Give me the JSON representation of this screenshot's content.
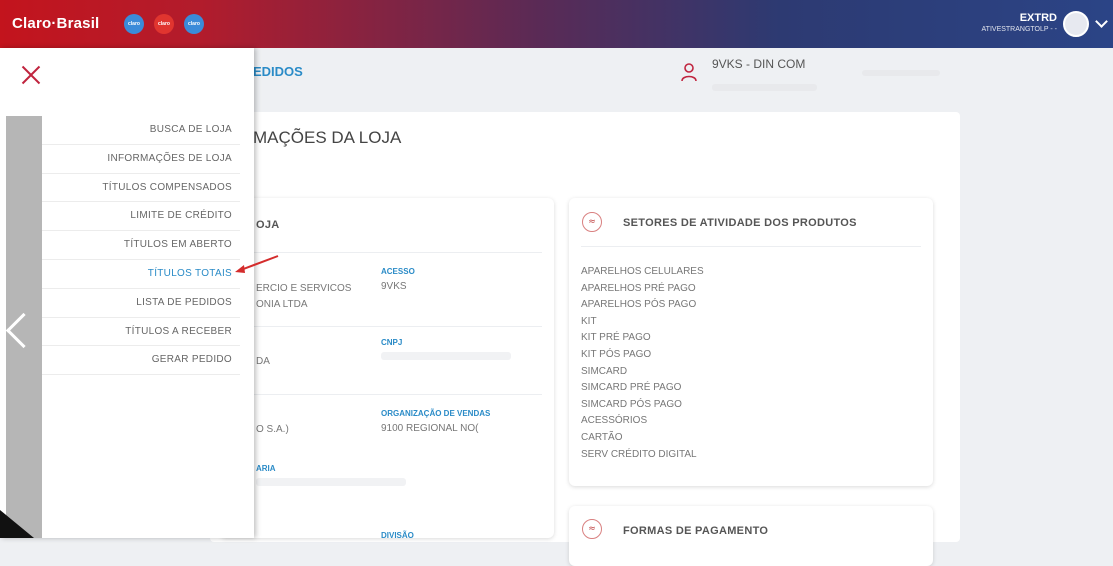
{
  "header": {
    "brand": "Claro·Brasil",
    "brand_circles": [
      {
        "label": "claro",
        "color": "#3b8bd9"
      },
      {
        "label": "claro",
        "color": "#e0352f"
      },
      {
        "label": "claro",
        "color": "#3b8bd9"
      }
    ],
    "user_name": "EXTRD",
    "user_sub": "ATIVESTRANGTOLP - -"
  },
  "page": {
    "title": "EDIDOS"
  },
  "store": {
    "name": "9VKS - DIN COM"
  },
  "section": {
    "title": "MAÇÕES DA LOJA"
  },
  "left_card": {
    "title": "OJA",
    "fields": [
      {
        "label": "ACESSO",
        "value": "9VKS"
      },
      {
        "label": "CNPJ",
        "value": ""
      },
      {
        "label": "ORGANIZAÇÃO DE VENDAS",
        "value": "9100 REGIONAL NO("
      },
      {
        "label": "ARIA",
        "value": ""
      },
      {
        "label": "DIVISÃO",
        "value": ""
      }
    ],
    "left_values": [
      "ERCIO E SERVICOS",
      "ONIA LTDA",
      "DA",
      "O S.A.)"
    ]
  },
  "right_card": {
    "title": "SETORES DE ATIVIDADE DOS PRODUTOS",
    "items": [
      "APARELHOS CELULARES",
      "APARELHOS PRÉ PAGO",
      "APARELHOS PÓS PAGO",
      "KIT",
      "KIT PRÉ PAGO",
      "KIT PÓS PAGO",
      "SIMCARD",
      "SIMCARD PRÉ PAGO",
      "SIMCARD PÓS PAGO",
      "ACESSÓRIOS",
      "CARTÃO",
      "SERV CRÉDITO DIGITAL"
    ]
  },
  "right_card2": {
    "title": "FORMAS DE PAGAMENTO"
  },
  "menu": {
    "items": [
      {
        "label": "BUSCA DE LOJA"
      },
      {
        "label": "INFORMAÇÕES DE LOJA"
      },
      {
        "label": "TÍTULOS COMPENSADOS"
      },
      {
        "label": "LIMITE DE CRÉDITO"
      },
      {
        "label": "TÍTULOS EM ABERTO"
      },
      {
        "label": "TÍTULOS TOTAIS"
      },
      {
        "label": "LISTA DE PEDIDOS"
      },
      {
        "label": "TÍTULOS A RECEBER"
      },
      {
        "label": "GERAR PEDIDO"
      }
    ],
    "active_index": 5
  }
}
